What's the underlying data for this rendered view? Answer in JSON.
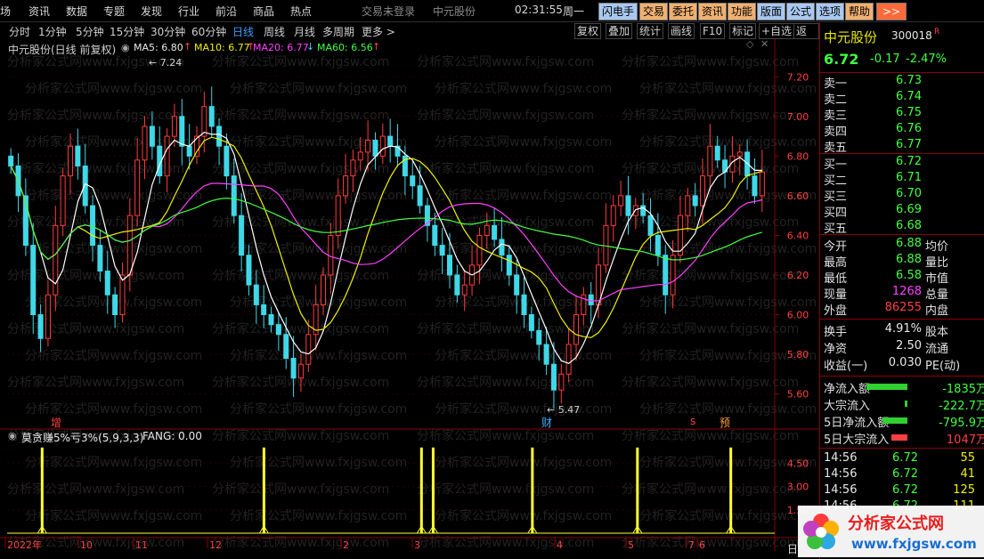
{
  "menu": {
    "items": [
      "场",
      "资讯",
      "数据",
      "专题",
      "发现",
      "行业",
      "前沿",
      "商品",
      "热点"
    ],
    "status_login": "交易未登录",
    "status_stock": "中元股份",
    "time": "02:31:55",
    "weekday": "周一",
    "buttons": [
      "闪电手",
      "交易",
      "委托",
      "资讯",
      "功能",
      "版面",
      "公式",
      "选项",
      "帮助"
    ],
    "more": ">>"
  },
  "periods": [
    "分时",
    "1分钟",
    "5分钟",
    "15分钟",
    "30分钟",
    "60分钟",
    "日线",
    "周线",
    "月线",
    "多周期",
    "更多 >"
  ],
  "active_period": "日线",
  "tools": [
    "复权",
    "叠加",
    "统计",
    "画线",
    "F10",
    "标记",
    "+自选",
    "返回"
  ],
  "chart_header": {
    "name": "中元股份(日线 前复权)",
    "ma5": "MA5: 6.80",
    "ma10": "MA10: 6.77",
    "ma20": "MA20: 6.77",
    "ma60": "MA60: 6.56",
    "arrow_up": "↑",
    "arrow_down": "↓"
  },
  "chart_data": {
    "type": "candlestick",
    "ylim": [
      5.45,
      7.3
    ],
    "y_ticks": [
      "7.20",
      "7.00",
      "6.80",
      "6.60",
      "6.40",
      "6.20",
      "6.00",
      "5.80",
      "5.60"
    ],
    "high_marker": "7.24",
    "low_marker": "5.47",
    "event_markers": [
      "增",
      "财",
      "s",
      "预"
    ],
    "closes": [
      6.75,
      6.6,
      6.35,
      6.0,
      5.88,
      6.1,
      6.45,
      6.7,
      6.85,
      6.75,
      6.55,
      6.35,
      6.22,
      6.1,
      6.0,
      6.2,
      6.5,
      6.78,
      6.95,
      6.85,
      6.7,
      6.9,
      7.0,
      6.85,
      6.8,
      6.9,
      7.05,
      6.95,
      6.85,
      6.7,
      6.5,
      6.3,
      6.15,
      6.05,
      6.0,
      5.95,
      5.9,
      5.78,
      5.68,
      5.75,
      5.9,
      6.05,
      6.2,
      6.4,
      6.6,
      6.7,
      6.78,
      6.82,
      6.88,
      6.8,
      6.9,
      6.85,
      6.8,
      6.7,
      6.65,
      6.55,
      6.45,
      6.35,
      6.3,
      6.2,
      6.1,
      6.15,
      6.25,
      6.4,
      6.45,
      6.38,
      6.3,
      6.2,
      6.1,
      6.0,
      5.92,
      5.85,
      5.75,
      5.62,
      5.7,
      5.85,
      6.0,
      6.1,
      6.05,
      6.25,
      6.45,
      6.55,
      6.6,
      6.5,
      6.55,
      6.5,
      6.4,
      6.3,
      6.1,
      6.3,
      6.5,
      6.6,
      6.55,
      6.7,
      6.85,
      6.78,
      6.72,
      6.8,
      6.82,
      6.7,
      6.6,
      6.72
    ]
  },
  "indicator": {
    "name": "莫贪赚5%亏3%(5,9,3,3)",
    "value": "FANG: 0.00",
    "y_ticks": [
      "4.50",
      "3.00",
      "1.50"
    ],
    "spikes": [
      6,
      44,
      71,
      73,
      90,
      108,
      124
    ]
  },
  "x_labels": [
    "2022年",
    "10",
    "11",
    "12",
    "2",
    "3",
    "4",
    "5",
    "6",
    "7"
  ],
  "x_right_label": "日",
  "quote": {
    "name": "中元股份",
    "code": "300018",
    "flag": "R",
    "price": "6.72",
    "change": "-0.17",
    "pct": "-2.47%",
    "asks": [
      {
        "label": "卖五",
        "price": "6.77"
      },
      {
        "label": "卖四",
        "price": "6.76"
      },
      {
        "label": "卖三",
        "price": "6.75"
      },
      {
        "label": "卖二",
        "price": "6.74"
      },
      {
        "label": "卖一",
        "price": "6.73"
      }
    ],
    "bids": [
      {
        "label": "买一",
        "price": "6.72"
      },
      {
        "label": "买二",
        "price": "6.71"
      },
      {
        "label": "买三",
        "price": "6.70"
      },
      {
        "label": "买四",
        "price": "6.69"
      },
      {
        "label": "买五",
        "price": "6.68"
      }
    ],
    "stats": [
      {
        "k": "今开",
        "v": "6.88",
        "k2": "均价"
      },
      {
        "k": "最高",
        "v": "6.88",
        "k2": "量比"
      },
      {
        "k": "最低",
        "v": "6.58",
        "k2": "市值"
      },
      {
        "k": "现量",
        "v": "1268",
        "k2": "总量"
      },
      {
        "k": "外盘",
        "v": "86255",
        "k2": "内盘"
      }
    ],
    "stats2": [
      {
        "k": "换手",
        "v": "4.91%",
        "k2": "股本"
      },
      {
        "k": "净资",
        "v": "2.50",
        "k2": "流通"
      },
      {
        "k": "收益(一)",
        "v": "0.030",
        "k2": "PE(动)"
      }
    ],
    "flows": [
      {
        "k": "净流入额",
        "v": "-1835万"
      },
      {
        "k": "大宗流入",
        "v": "-222.7万"
      },
      {
        "k": "5日净流入额",
        "v": "-795.9万"
      },
      {
        "k": "5日大宗流入",
        "v": "1047万"
      }
    ],
    "ticks": [
      {
        "t": "14:56",
        "p": "6.72",
        "v": "55"
      },
      {
        "t": "14:56",
        "p": "6.72",
        "v": "41"
      },
      {
        "t": "14:56",
        "p": "6.72",
        "v": "125"
      },
      {
        "t": "14:56",
        "p": "6.72",
        "v": "111"
      }
    ]
  },
  "watermark": "分析家公式网www.fxjgsw.com",
  "logo": {
    "title": "分析家公式网",
    "url": "www.fxjgsw.com"
  }
}
